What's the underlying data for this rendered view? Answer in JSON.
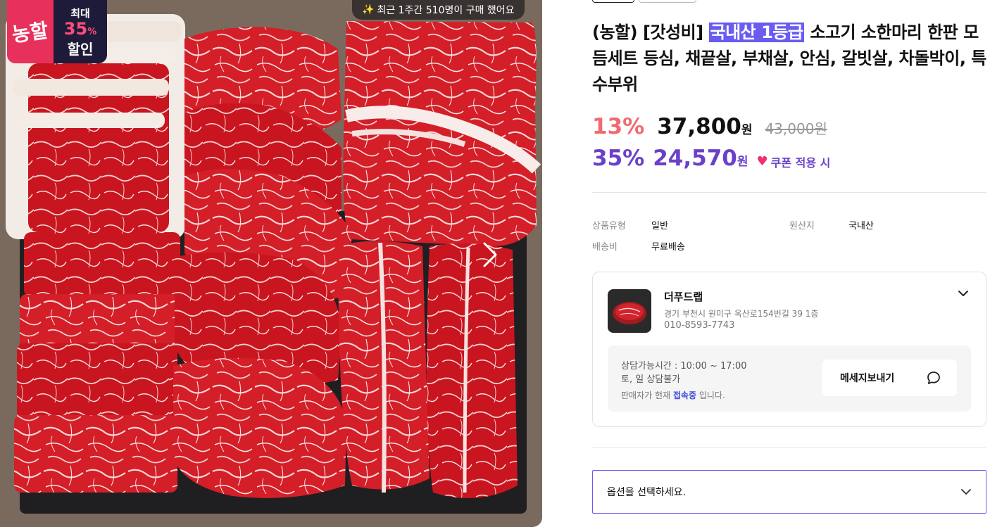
{
  "badge": {
    "brand": "농할",
    "max_label": "최대",
    "percent": "35",
    "percent_sign": "%",
    "discount_label": "할인"
  },
  "buyers_notice": "최근 1주간 510명이 구매 했어요",
  "product": {
    "title_prefix": "(농할) [갓성비] ",
    "title_highlight": "국내산 1등급",
    "title_suffix": " 소고기 소한마리 한판 모듬세트 등심, 채끝살, 부채살, 안심, 갈빗살, 차돌박이, 특수부위"
  },
  "pricing": {
    "discount_rate": "13%",
    "price": "37,800",
    "currency": "원",
    "original_price": "43,000원",
    "coupon_rate": "35%",
    "coupon_price": "24,570",
    "coupon_label": "쿠폰 적용 시"
  },
  "meta": {
    "type_label": "상품유형",
    "type_value": "일반",
    "origin_label": "원산지",
    "origin_value": "국내산",
    "shipping_label": "배송비",
    "shipping_value": "무료배송"
  },
  "seller": {
    "name": "더푸드랩",
    "address": "경기 부천시 원미구 옥산로154번길 39 1층",
    "phone": "010-8593-7743",
    "hours": "상담가능시간 : 10:00 ~ 17:00",
    "weekend": "토, 일 상담불가",
    "status_prefix": "판매자가 현재 ",
    "status_value": "접속중",
    "status_suffix": " 입니다.",
    "message_button": "메세지보내기"
  },
  "option": {
    "placeholder": "옵션을 선택하세요."
  },
  "colors": {
    "accent": "#6a5cf0",
    "discount": "#f16a6f",
    "coupon": "#6b40c9",
    "badge_pink": "#e8305d",
    "badge_navy": "#1e1b3a"
  }
}
